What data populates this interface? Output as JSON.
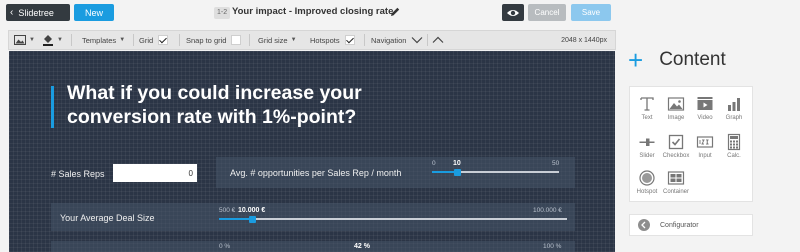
{
  "topbar": {
    "slidetree_label": "Slidetree",
    "new_label": "New",
    "slide_id": "1-2",
    "slide_title": "Your impact - Improved closing rate",
    "cancel_label": "Cancel",
    "save_label": "Save"
  },
  "toolbar": {
    "templates_label": "Templates",
    "grid_label": "Grid",
    "grid_checked": true,
    "snap_label": "Snap to grid",
    "snap_checked": false,
    "gridsize_label": "Grid size",
    "hotspots_label": "Hotspots",
    "hotspots_checked": true,
    "navigation_label": "Navigation",
    "resolution": "2048 x 1440px"
  },
  "slide": {
    "headline": "What if you could increase your conversion rate with 1%-point?",
    "sales_reps": {
      "label": "# Sales Reps",
      "value": "0"
    },
    "opportunities": {
      "label": "Avg. # opportunities per Sales Rep / month",
      "min": "0",
      "current": "10",
      "max": "50",
      "fraction": 0.2
    },
    "deal_size": {
      "label": "Your Average Deal Size",
      "min": "500 €",
      "current": "10.000 €",
      "max": "100.000 €",
      "fraction": 0.095
    },
    "rate": {
      "min": "0 %",
      "current": "42 %",
      "max": "100 %"
    }
  },
  "content_panel": {
    "title": "Content",
    "tools": [
      {
        "label": "Text",
        "icon": "text-icon"
      },
      {
        "label": "Image",
        "icon": "image-icon"
      },
      {
        "label": "Video",
        "icon": "video-icon"
      },
      {
        "label": "Graph",
        "icon": "graph-icon"
      },
      {
        "label": "Slider",
        "icon": "slider-icon"
      },
      {
        "label": "Checkbox",
        "icon": "checkbox-icon"
      },
      {
        "label": "Input",
        "icon": "input-icon"
      },
      {
        "label": "Calc.",
        "icon": "calculator-icon"
      },
      {
        "label": "Hotspot",
        "icon": "hotspot-icon"
      },
      {
        "label": "Container",
        "icon": "container-icon"
      }
    ],
    "configurator_label": "Configurator"
  },
  "colors": {
    "accent": "#1a9ce0",
    "canvas": "#2b3546",
    "dark_button": "#333a40"
  }
}
